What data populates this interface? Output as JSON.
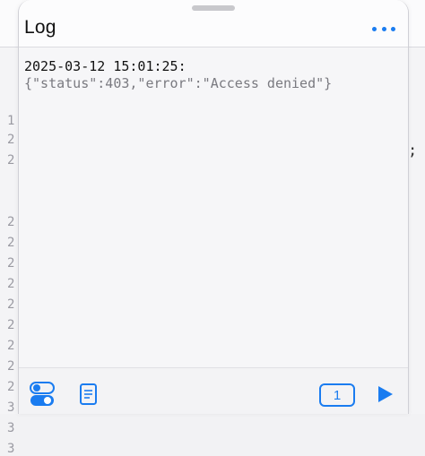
{
  "background": {
    "gutter_chars": [
      "1",
      "2",
      "2",
      "2",
      "2",
      "2",
      "2",
      "2",
      "2",
      "2",
      "2",
      "2",
      "3",
      "3",
      "3"
    ],
    "trailing_char": ";"
  },
  "header": {
    "title": "Log",
    "more_icon": "ellipsis-icon"
  },
  "log": {
    "entries": [
      {
        "timestamp": "2025-03-12 15:01:25:",
        "message": "{\"status\":403,\"error\":\"Access denied\"}"
      }
    ]
  },
  "toolbar": {
    "toggle_icon": "toggle-settings-icon",
    "document_icon": "document-icon",
    "count": "1",
    "play_icon": "play-icon"
  },
  "colors": {
    "accent": "#1a7cf0",
    "text": "#111111",
    "muted_text": "#7a7a80",
    "background": "#f6f6f8"
  }
}
